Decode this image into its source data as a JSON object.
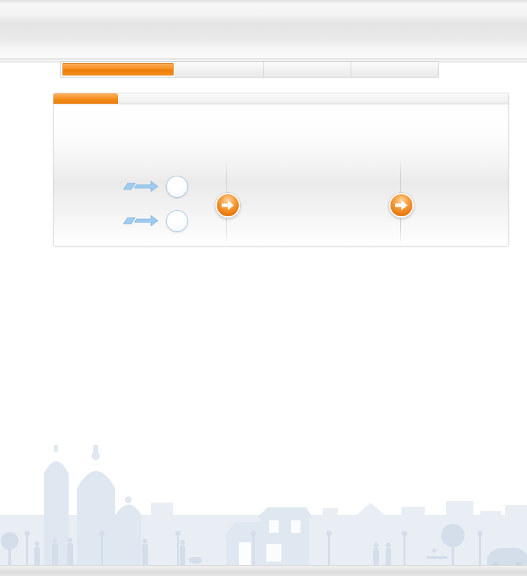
{
  "header": {
    "title": ""
  },
  "nav": {
    "items": [
      {
        "label": ""
      },
      {
        "label": ""
      },
      {
        "label": ""
      },
      {
        "label": ""
      }
    ]
  },
  "panel": {
    "tab_label": "",
    "inputs": [
      {
        "value": ""
      },
      {
        "value": ""
      }
    ]
  },
  "colors": {
    "accent": "#f38a17",
    "circle_border": "#a8c8e4",
    "arrow_blue": "#8dbfe8",
    "skyline": "#e4ebf3"
  },
  "icons": {
    "input_arrow": "double-arrow-right-icon",
    "go": "arrow-right-icon"
  }
}
